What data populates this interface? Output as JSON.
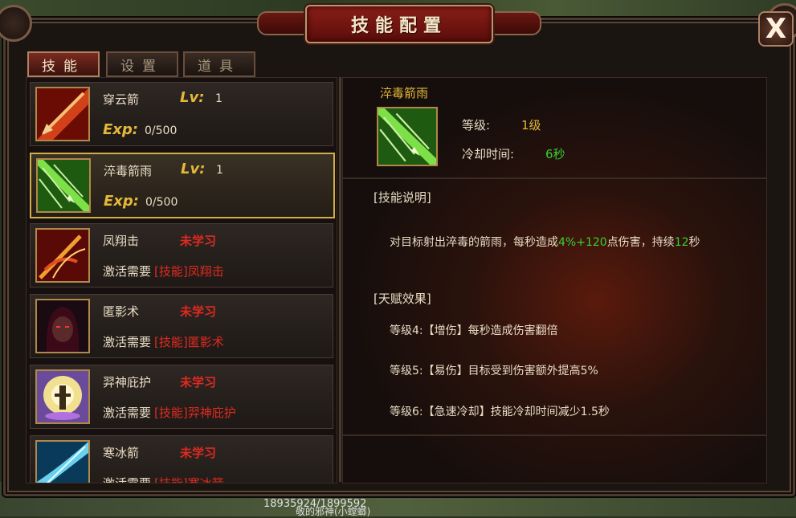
{
  "window": {
    "title": "技能配置",
    "close_label": "X"
  },
  "tabs": [
    {
      "label": "技能",
      "active": true
    },
    {
      "label": "设置",
      "active": false
    },
    {
      "label": "道具",
      "active": false
    }
  ],
  "skills": [
    {
      "name": "穿云箭",
      "learned": true,
      "lv_label": "Lv:",
      "level": "1",
      "exp_label": "Exp:",
      "exp": "0/500",
      "icon": "fire-arrow-icon"
    },
    {
      "name": "淬毒箭雨",
      "learned": true,
      "selected": true,
      "lv_label": "Lv:",
      "level": "1",
      "exp_label": "Exp:",
      "exp": "0/500",
      "icon": "poison-arrow-rain-icon"
    },
    {
      "name": "凤翔击",
      "learned": false,
      "status": "未学习",
      "req_prefix": "激活需要",
      "req_tag": "[技能]凤翔击",
      "icon": "phoenix-strike-icon"
    },
    {
      "name": "匿影术",
      "learned": false,
      "status": "未学习",
      "req_prefix": "激活需要",
      "req_tag": "[技能]匿影术",
      "icon": "shadow-hood-icon"
    },
    {
      "name": "羿神庇护",
      "learned": false,
      "status": "未学习",
      "req_prefix": "激活需要",
      "req_tag": "[技能]羿神庇护",
      "icon": "divine-protection-icon"
    },
    {
      "name": "寒冰箭",
      "learned": false,
      "status": "未学习",
      "req_prefix": "激活需要",
      "req_tag": "[技能]寒冰箭",
      "icon": "ice-arrow-icon"
    }
  ],
  "detail": {
    "name": "淬毒箭雨",
    "level_label": "等级:",
    "level_value": "1级",
    "cooldown_label": "冷却时间:",
    "cooldown_value": "6秒",
    "description_title": "[技能说明]",
    "description": {
      "p1": "对目标射出淬毒的箭雨，每秒造成",
      "v1": "4%",
      "p2": "+",
      "v2": "120",
      "p3": "点伤害，持续",
      "v3": "12",
      "p4": "秒"
    },
    "talent_title": "[天赋效果]",
    "talents": [
      "等级4:【增伤】每秒造成伤害翻倍",
      "等级5:【易伤】目标受到伤害额外提高5%",
      "等级6:【急速冷却】技能冷却时间减少1.5秒"
    ]
  },
  "footer": {
    "coords": "18935924/1899592",
    "text": "敬的邪神(小螳螂)"
  },
  "colors": {
    "gold": "#e5b83a",
    "red": "#e02a20",
    "green": "#39d12f",
    "title_red": "#8a1e18"
  }
}
